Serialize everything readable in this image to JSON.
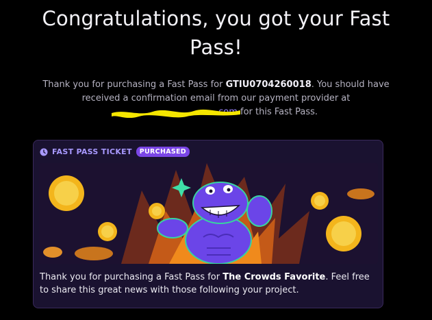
{
  "heading": "Congratulations, you got your Fast Pass!",
  "message": {
    "pre": "Thank you for purchasing a Fast Pass for ",
    "code": "GTIU0704260018",
    "mid": ". You should have received a confirmation email from our payment provider at ",
    "email_visible": ".com",
    "post": " for this Fast Pass."
  },
  "ticket": {
    "icon": "clock-icon",
    "label": "FAST PASS TICKET",
    "badge": "PURCHASED",
    "text_pre": "Thank you for purchasing a Fast Pass for ",
    "project": "The Crowds Favorite",
    "text_post": ". Feel free to share this great news with those following your project."
  },
  "colors": {
    "background": "#000000",
    "card": "#1a1230",
    "accent": "#7b46e6",
    "redaction": "#f5e600"
  }
}
